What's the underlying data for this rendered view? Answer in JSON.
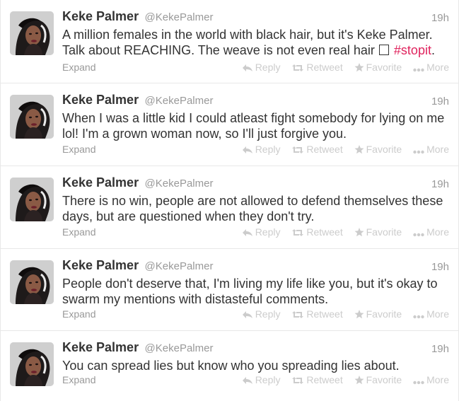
{
  "tweets": [
    {
      "fullname": "Keke Palmer",
      "username": "@KekePalmer",
      "time": "19h",
      "text": "A million females in the world with black hair, but it's Keke Palmer. Talk about REACHING. The weave is not even real hair",
      "hashtag": "#stopit",
      "hashtag_suffix": "."
    },
    {
      "fullname": "Keke Palmer",
      "username": "@KekePalmer",
      "time": "19h",
      "text": "When I was a little kid I could atleast fight somebody for lying on me lol! I'm a grown woman now, so I'll just forgive you."
    },
    {
      "fullname": "Keke Palmer",
      "username": "@KekePalmer",
      "time": "19h",
      "text": "There is no win, people are not allowed to defend themselves these days, but are questioned when they don't try."
    },
    {
      "fullname": "Keke Palmer",
      "username": "@KekePalmer",
      "time": "19h",
      "text": "People don't deserve that, I'm living my life like you, but it's okay to swarm my mentions with distasteful comments."
    },
    {
      "fullname": "Keke Palmer",
      "username": "@KekePalmer",
      "time": "19h",
      "text": "You can spread lies but know who you spreading lies about."
    }
  ],
  "actions": {
    "expand": "Expand",
    "reply": "Reply",
    "retweet": "Retweet",
    "favorite": "Favorite",
    "more": "More"
  },
  "icons": {
    "reply": "reply-arrow-icon",
    "retweet": "retweet-icon",
    "favorite": "star-icon",
    "more": "dots-icon",
    "hashtag_box": "empty-box-glyph"
  },
  "colors": {
    "text": "#333333",
    "muted": "#999999",
    "action": "#cccccc",
    "hashtag": "#e0245e",
    "divider": "#e8e8e8"
  }
}
